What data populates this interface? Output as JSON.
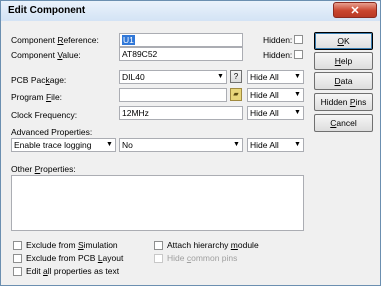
{
  "window": {
    "title": "Edit Component",
    "close_glyph": "✕"
  },
  "fields": {
    "reference": {
      "label_u": "R",
      "label_pre": "Component ",
      "label_post": "eference:",
      "value": "U1"
    },
    "value": {
      "label_pre": "Component ",
      "label_u": "V",
      "label_post": "alue:",
      "value": "AT89C52"
    },
    "pcb_package": {
      "label_pre": "PCB Pac",
      "label_u": "k",
      "label_post": "age:",
      "value": "DIL40"
    },
    "program_file": {
      "label_pre": "Program ",
      "label_u": "F",
      "label_post": "ile:",
      "value": ""
    },
    "clock_frequency": {
      "label_pre": "Clock Frequency:",
      "value": "12MHz"
    },
    "advanced_label": {
      "label_pre": "Advanced Properties:"
    },
    "advanced_property": "Enable trace logging",
    "advanced_value": "No"
  },
  "hidden_label": "Hidden:",
  "hide_all": "Hide All",
  "question": "?",
  "browse_icon": "folder-icon",
  "other_properties": {
    "label_pre": "Other ",
    "label_u": "P",
    "label_post": "roperties:"
  },
  "buttons": {
    "ok": {
      "u": "O",
      "rest": "K"
    },
    "help": {
      "u": "H",
      "rest": "elp"
    },
    "data": {
      "u": "D",
      "rest": "ata"
    },
    "hidden_pins": {
      "pre": "Hidden ",
      "u": "P",
      "rest": "ins"
    },
    "cancel": {
      "u": "C",
      "rest": "ancel"
    }
  },
  "checkboxes": {
    "exclude_sim": {
      "pre": "Exclude from ",
      "u": "S",
      "post": "imulation"
    },
    "exclude_pcb": {
      "pre": "Exclude from PCB ",
      "u": "L",
      "post": "ayout"
    },
    "edit_all": {
      "pre": "Edit ",
      "u": "a",
      "post": "ll properties as text"
    },
    "attach_hier": {
      "pre": "Attach hierarchy ",
      "u": "m",
      "post": "odule"
    },
    "hide_pins": {
      "pre": "Hide ",
      "u": "c",
      "post": "ommon pins"
    }
  }
}
